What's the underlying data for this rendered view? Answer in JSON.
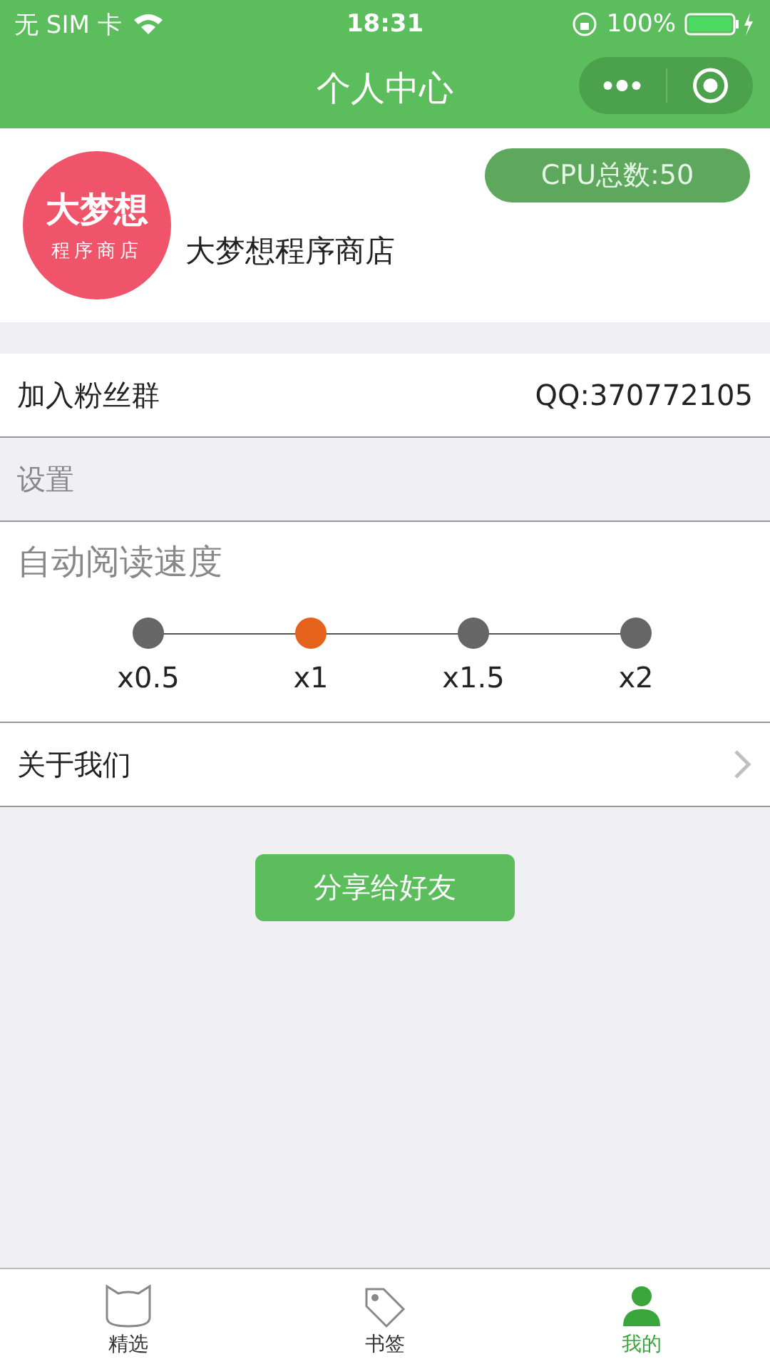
{
  "status_bar": {
    "carrier": "无 SIM 卡",
    "time": "18:31",
    "battery": "100%"
  },
  "nav": {
    "title": "个人中心"
  },
  "profile": {
    "logo_line_1": "大梦想",
    "logo_line_2": "程序商店",
    "name": "大梦想程序商店",
    "cpu_badge": "CPU总数:50"
  },
  "rows": [
    {
      "kind": "info",
      "label": "加入粉丝群",
      "value": "QQ:370772105"
    },
    {
      "kind": "section",
      "label": "设置"
    }
  ],
  "speed": {
    "title": "自动阅读速度",
    "options": [
      {
        "label": "x0.5",
        "selected": false
      },
      {
        "label": "x1",
        "selected": true
      },
      {
        "label": "x1.5",
        "selected": false
      },
      {
        "label": "x2",
        "selected": false
      }
    ]
  },
  "about": {
    "label": "关于我们"
  },
  "share_button": "分享给好友",
  "tab_bar": [
    {
      "label": "精选",
      "kind": "cat",
      "selected": false
    },
    {
      "label": "书签",
      "kind": "tag",
      "selected": false
    },
    {
      "label": "我的",
      "kind": "person",
      "selected": true
    }
  ]
}
